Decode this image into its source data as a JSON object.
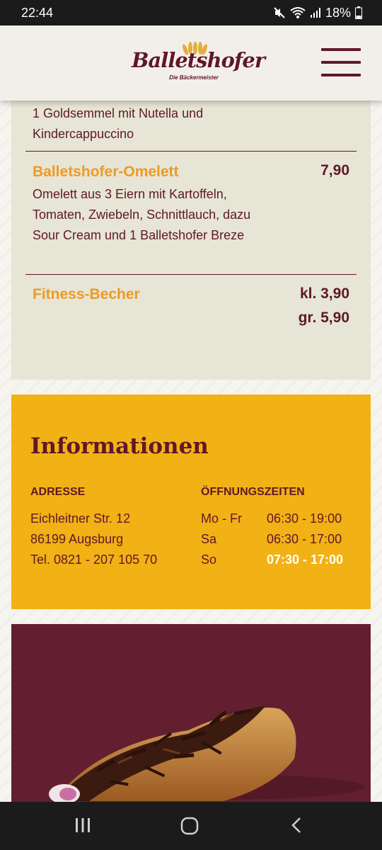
{
  "status_bar": {
    "time": "22:44",
    "battery": "18%",
    "icons": [
      "mute-icon",
      "wifi-icon",
      "signal-icon",
      "battery-icon"
    ]
  },
  "header": {
    "logo_text": "Balletshofer",
    "logo_subtitle": "Die Bäckermeister",
    "menu_icon": "hamburger-menu-icon"
  },
  "menu": {
    "partial_item_description": "1 Goldsemmel mit Nutella und Kindercappuccino",
    "items": [
      {
        "name": "Balletshofer-Omelett",
        "price": "7,90",
        "description": "Omelett aus 3 Eiern mit Kartoffeln, Tomaten, Zwiebeln, Schnittlauch, dazu Sour Cream und 1 Balletshofer Breze"
      },
      {
        "name": "Fitness-Becher",
        "price_small": "kl. 3,90",
        "price_large": "gr. 5,90"
      }
    ]
  },
  "info": {
    "title": "Informationen",
    "address_label": "ADRESSE",
    "address_lines": [
      "Eichleitner Str. 12",
      "86199 Augsburg",
      "Tel. 0821 - 207 105 70"
    ],
    "hours_label": "ÖFFNUNGSZEITEN",
    "hours": [
      {
        "day": "Mo - Fr",
        "time": "06:30 - 19:00"
      },
      {
        "day": "Sa",
        "time": "06:30 - 17:00"
      },
      {
        "day": "So",
        "time": "07:30 - 17:00"
      }
    ]
  },
  "promo": {
    "image": "chocolate-pastry-image"
  },
  "nav": {
    "icons": [
      "recent-apps-icon",
      "home-icon",
      "back-icon"
    ]
  },
  "colors": {
    "brand": "#5f1828",
    "accent_orange": "#ec9a26",
    "info_yellow": "#f2b114",
    "card_beige": "#e7e5d5",
    "promo_bg": "#631f2f"
  }
}
